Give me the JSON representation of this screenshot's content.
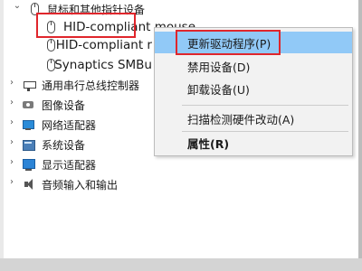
{
  "tree": {
    "category_mouse": {
      "expander": "⌄",
      "label": "鼠标和其他指针设备"
    },
    "children": [
      {
        "label": "HID-compliant mouse"
      },
      {
        "label": "HID-compliant r"
      },
      {
        "label": "Synaptics SMBu"
      }
    ],
    "categories": [
      {
        "expander": "›",
        "label": "通用串行总线控制器"
      },
      {
        "expander": "›",
        "label": "图像设备"
      },
      {
        "expander": "›",
        "label": "网络适配器"
      },
      {
        "expander": "›",
        "label": "系统设备"
      },
      {
        "expander": "›",
        "label": "显示适配器"
      },
      {
        "expander": "›",
        "label": "音频输入和输出"
      }
    ]
  },
  "context_menu": {
    "items": [
      {
        "label": "更新驱动程序(P)",
        "highlighted": true
      },
      {
        "label": "禁用设备(D)"
      },
      {
        "label": "卸载设备(U)"
      },
      {
        "label": "扫描检测硬件改动(A)"
      },
      {
        "label": "属性(R)",
        "bold": true
      }
    ]
  },
  "colors": {
    "highlight_red": "#e0262c",
    "menu_hover": "#91c9f7",
    "menu_bg": "#f2f2f2"
  }
}
